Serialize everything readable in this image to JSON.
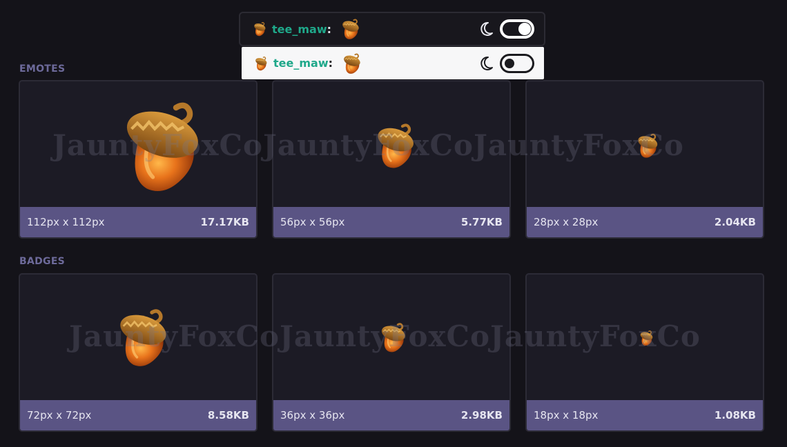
{
  "chat_preview": {
    "username": "tee_maw",
    "colon": ":",
    "dark_mode_icon": "moon-icon",
    "light_mode_icon": "moon-icon"
  },
  "sections": {
    "emotes_label": "EMOTES",
    "badges_label": "BADGES"
  },
  "emotes": [
    {
      "size": "112px x 112px",
      "filesize": "17.17KB"
    },
    {
      "size": "56px x 56px",
      "filesize": "5.77KB"
    },
    {
      "size": "28px x 28px",
      "filesize": "2.04KB"
    }
  ],
  "badges": [
    {
      "size": "72px x 72px",
      "filesize": "8.58KB"
    },
    {
      "size": "36px x 36px",
      "filesize": "2.98KB"
    },
    {
      "size": "18px x 18px",
      "filesize": "1.08KB"
    }
  ],
  "watermark": "JauntyFoxCoJauntyFoxCoJauntyFoxCo",
  "colors": {
    "background": "#141319",
    "card": "#1c1b25",
    "footer": "#5a5484",
    "username": "#1fa88a",
    "acorn": "#e0701a"
  }
}
